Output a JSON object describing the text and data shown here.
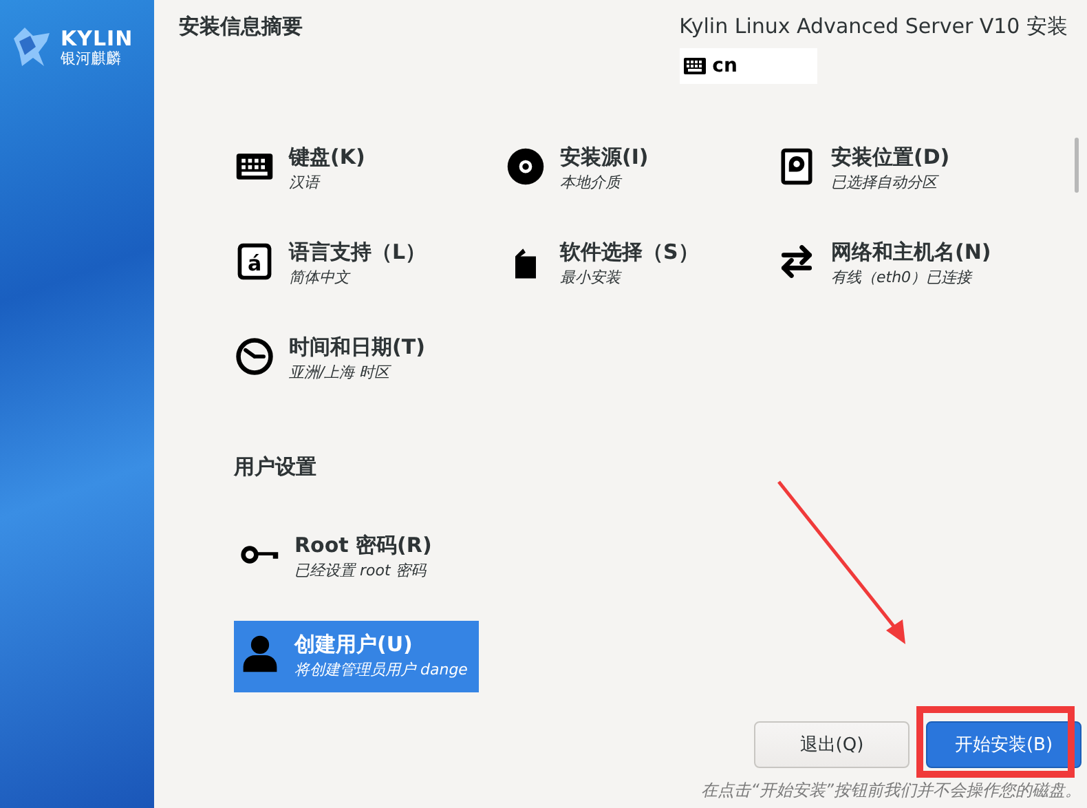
{
  "sidebar": {
    "logo_text": "KYLIN",
    "logo_subtext": "银河麒麟"
  },
  "header": {
    "title": "安装信息摘要",
    "product": "Kylin Linux Advanced Server V10 安装",
    "keyboard_layout": "cn"
  },
  "spokes": [
    {
      "kind": "keyboard",
      "title": "键盘(K)",
      "status": "汉语"
    },
    {
      "kind": "disc",
      "title": "安装源(I)",
      "status": "本地介质"
    },
    {
      "kind": "drive",
      "title": "安装位置(D)",
      "status": "已选择自动分区"
    },
    {
      "kind": "language",
      "icon_glyph": "á",
      "title": "语言支持（L）",
      "status": "简体中文"
    },
    {
      "kind": "package",
      "title": "软件选择（S）",
      "status": "最小安装"
    },
    {
      "kind": "network",
      "title": "网络和主机名(N)",
      "status": "有线（eth0）已连接"
    },
    {
      "kind": "clock",
      "title": "时间和日期(T)",
      "status": "亚洲/上海 时区"
    }
  ],
  "user_settings": {
    "heading": "用户设置",
    "items": [
      {
        "kind": "key",
        "title": "Root 密码(R)",
        "status": "已经设置 root 密码",
        "selected": false
      },
      {
        "kind": "user",
        "title": "创建用户(U)",
        "status": "将创建管理员用户 dange",
        "selected": true
      }
    ]
  },
  "buttons": [
    {
      "kind": "secondary",
      "label": "退出(Q)"
    },
    {
      "kind": "primary",
      "label": "开始安装(B)"
    }
  ],
  "footer_note": "在点击“开始安装”按钮前我们并不会操作您的磁盘。"
}
